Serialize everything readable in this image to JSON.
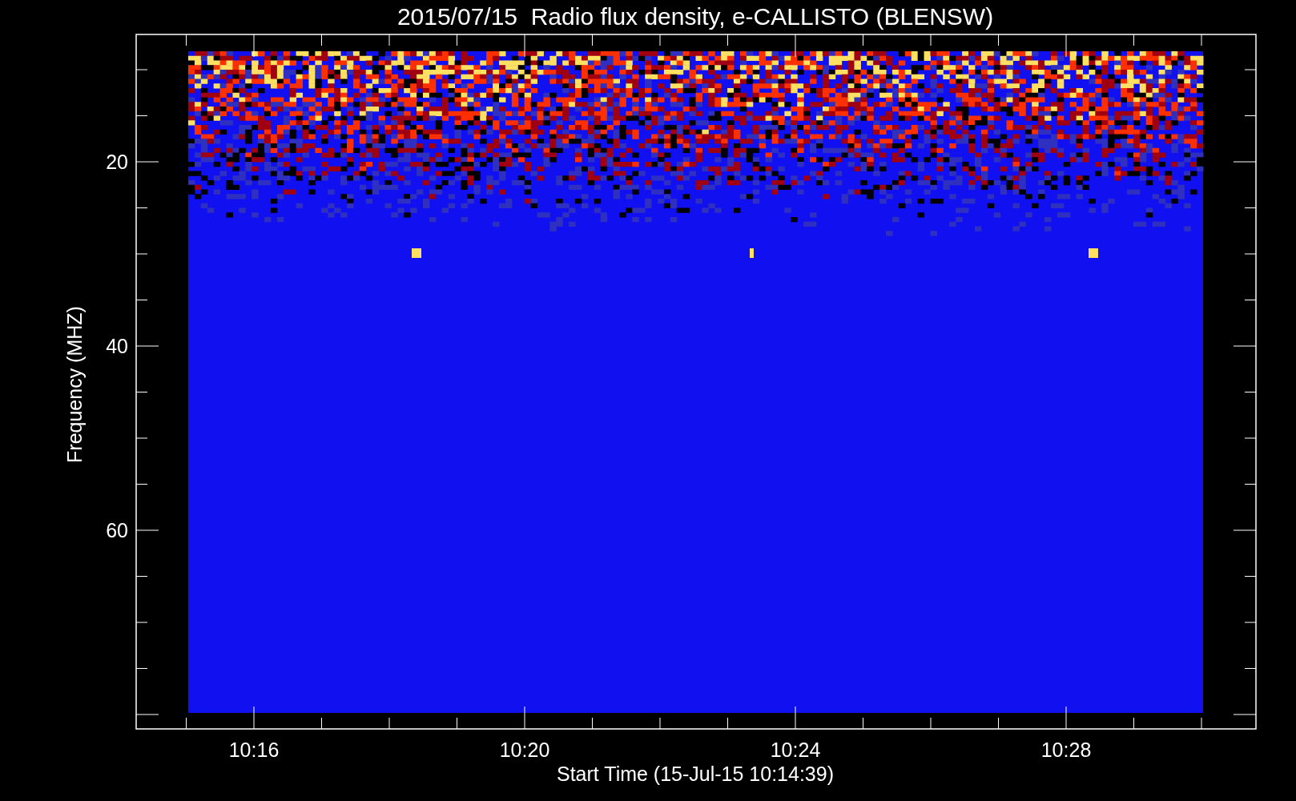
{
  "title": "2015/07/15  Radio flux density, e-CALLISTO (BLENSW)",
  "y_axis": {
    "label": "Frequency (MHZ)",
    "ticks": [
      "20",
      "40",
      "60"
    ]
  },
  "x_axis": {
    "label": "Start Time (15-Jul-15 10:14:39)",
    "ticks": [
      "10:16",
      "10:20",
      "10:24",
      "10:28"
    ]
  }
}
